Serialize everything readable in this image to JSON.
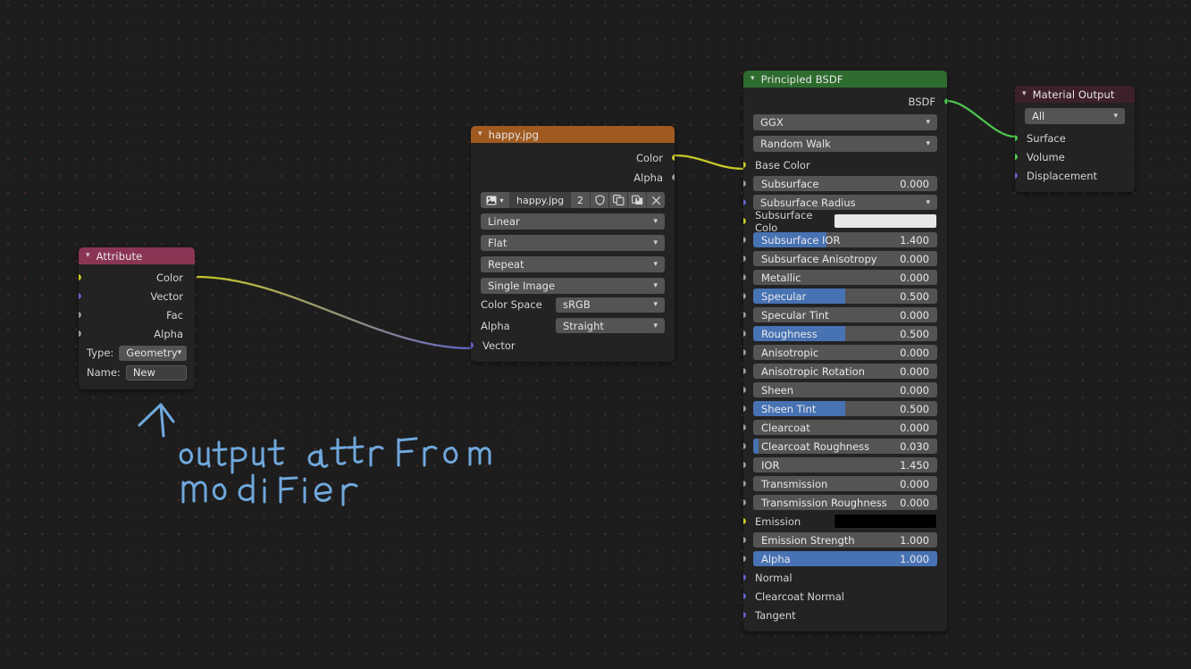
{
  "app": {
    "editor": "blender-shader-node-editor"
  },
  "annotation": {
    "text_line1": "output attr from",
    "text_line2": "modifier",
    "color": "#6fa8dc",
    "arrow": "up-arrow"
  },
  "nodes": {
    "attribute": {
      "title": "Attribute",
      "header_color": "#8b3555",
      "outputs": [
        {
          "label": "Color",
          "socket": "yellow"
        },
        {
          "label": "Vector",
          "socket": "purple"
        },
        {
          "label": "Fac",
          "socket": "grey"
        },
        {
          "label": "Alpha",
          "socket": "grey"
        }
      ],
      "fields": [
        {
          "label": "Type:",
          "value": "Geometry",
          "widget": "dropdown"
        },
        {
          "label": "Name:",
          "value": "New",
          "widget": "text"
        }
      ]
    },
    "image_texture": {
      "title": "happy.jpg",
      "header_color": "#a05a20",
      "outputs": [
        {
          "label": "Color",
          "socket": "yellow"
        },
        {
          "label": "Alpha",
          "socket": "grey"
        }
      ],
      "toolbar": {
        "browse_icon": "image-datablock-icon",
        "browse_chevron": "chevron-down-icon",
        "name": "happy.jpg",
        "users_count": "2",
        "fake_user_icon": "shield-icon",
        "new_copy_icon": "duplicate-icon",
        "pack_icon": "pack-file-icon",
        "unlink_icon": "close-icon"
      },
      "dropdowns": [
        {
          "name": "interpolation",
          "value": "Linear"
        },
        {
          "name": "projection",
          "value": "Flat"
        },
        {
          "name": "extension",
          "value": "Repeat"
        },
        {
          "name": "source",
          "value": "Single Image"
        }
      ],
      "labeled_dropdowns": [
        {
          "label": "Color Space",
          "value": "sRGB"
        },
        {
          "label": "Alpha",
          "value": "Straight"
        }
      ],
      "inputs": [
        {
          "label": "Vector",
          "socket": "purple"
        }
      ]
    },
    "principled_bsdf": {
      "title": "Principled BSDF",
      "header_color": "#2e6b2e",
      "outputs": [
        {
          "label": "BSDF",
          "socket": "green"
        }
      ],
      "dropdowns": [
        {
          "name": "distribution",
          "value": "GGX"
        },
        {
          "name": "subsurface_method",
          "value": "Random Walk"
        }
      ],
      "inputs": [
        {
          "label": "Base Color",
          "socket": "yellow",
          "widget": "none"
        },
        {
          "label": "Subsurface",
          "socket": "grey",
          "widget": "slider",
          "value": "0.000",
          "fill": 0
        },
        {
          "label": "Subsurface Radius",
          "socket": "purple",
          "widget": "dropdown",
          "value": "Subsurface Radius"
        },
        {
          "label": "Subsurface Colo",
          "socket": "yellow",
          "widget": "swatch",
          "color": "#e8e8e8"
        },
        {
          "label": "Subsurface IOR",
          "socket": "grey",
          "widget": "slider",
          "value": "1.400",
          "fill": 40
        },
        {
          "label": "Subsurface Anisotropy",
          "socket": "grey",
          "widget": "slider",
          "value": "0.000",
          "fill": 0
        },
        {
          "label": "Metallic",
          "socket": "grey",
          "widget": "slider",
          "value": "0.000",
          "fill": 0
        },
        {
          "label": "Specular",
          "socket": "grey",
          "widget": "slider",
          "value": "0.500",
          "fill": 50
        },
        {
          "label": "Specular Tint",
          "socket": "grey",
          "widget": "slider",
          "value": "0.000",
          "fill": 0
        },
        {
          "label": "Roughness",
          "socket": "grey",
          "widget": "slider",
          "value": "0.500",
          "fill": 50
        },
        {
          "label": "Anisotropic",
          "socket": "grey",
          "widget": "slider",
          "value": "0.000",
          "fill": 0
        },
        {
          "label": "Anisotropic Rotation",
          "socket": "grey",
          "widget": "slider",
          "value": "0.000",
          "fill": 0
        },
        {
          "label": "Sheen",
          "socket": "grey",
          "widget": "slider",
          "value": "0.000",
          "fill": 0
        },
        {
          "label": "Sheen Tint",
          "socket": "grey",
          "widget": "slider",
          "value": "0.500",
          "fill": 50
        },
        {
          "label": "Clearcoat",
          "socket": "grey",
          "widget": "slider",
          "value": "0.000",
          "fill": 0
        },
        {
          "label": "Clearcoat Roughness",
          "socket": "grey",
          "widget": "slider",
          "value": "0.030",
          "fill": 3
        },
        {
          "label": "IOR",
          "socket": "grey",
          "widget": "slider",
          "value": "1.450",
          "fill": 0
        },
        {
          "label": "Transmission",
          "socket": "grey",
          "widget": "slider",
          "value": "0.000",
          "fill": 0
        },
        {
          "label": "Transmission Roughness",
          "socket": "grey",
          "widget": "slider",
          "value": "0.000",
          "fill": 0
        },
        {
          "label": "Emission",
          "socket": "yellow",
          "widget": "swatch",
          "color": "#000000"
        },
        {
          "label": "Emission Strength",
          "socket": "grey",
          "widget": "slider",
          "value": "1.000",
          "fill": 0
        },
        {
          "label": "Alpha",
          "socket": "grey",
          "widget": "slider",
          "value": "1.000",
          "fill": 100
        },
        {
          "label": "Normal",
          "socket": "purple",
          "widget": "none"
        },
        {
          "label": "Clearcoat Normal",
          "socket": "purple",
          "widget": "none"
        },
        {
          "label": "Tangent",
          "socket": "purple",
          "widget": "none"
        }
      ]
    },
    "material_output": {
      "title": "Material Output",
      "header_color": "#3d2029",
      "dropdown": {
        "name": "target",
        "value": "All"
      },
      "inputs": [
        {
          "label": "Surface",
          "socket": "green"
        },
        {
          "label": "Volume",
          "socket": "green"
        },
        {
          "label": "Displacement",
          "socket": "purple"
        }
      ]
    }
  },
  "links": [
    {
      "from": "attribute.Color",
      "to": "image_texture.Vector",
      "from_color": "#c7c729",
      "to_color": "#6363c7"
    },
    {
      "from": "image_texture.Color",
      "to": "principled_bsdf.BaseColor",
      "from_color": "#c7c729",
      "to_color": "#c7c729"
    },
    {
      "from": "principled_bsdf.BSDF",
      "to": "material_output.Surface",
      "from_color": "#4ec34e",
      "to_color": "#4ec34e"
    }
  ]
}
